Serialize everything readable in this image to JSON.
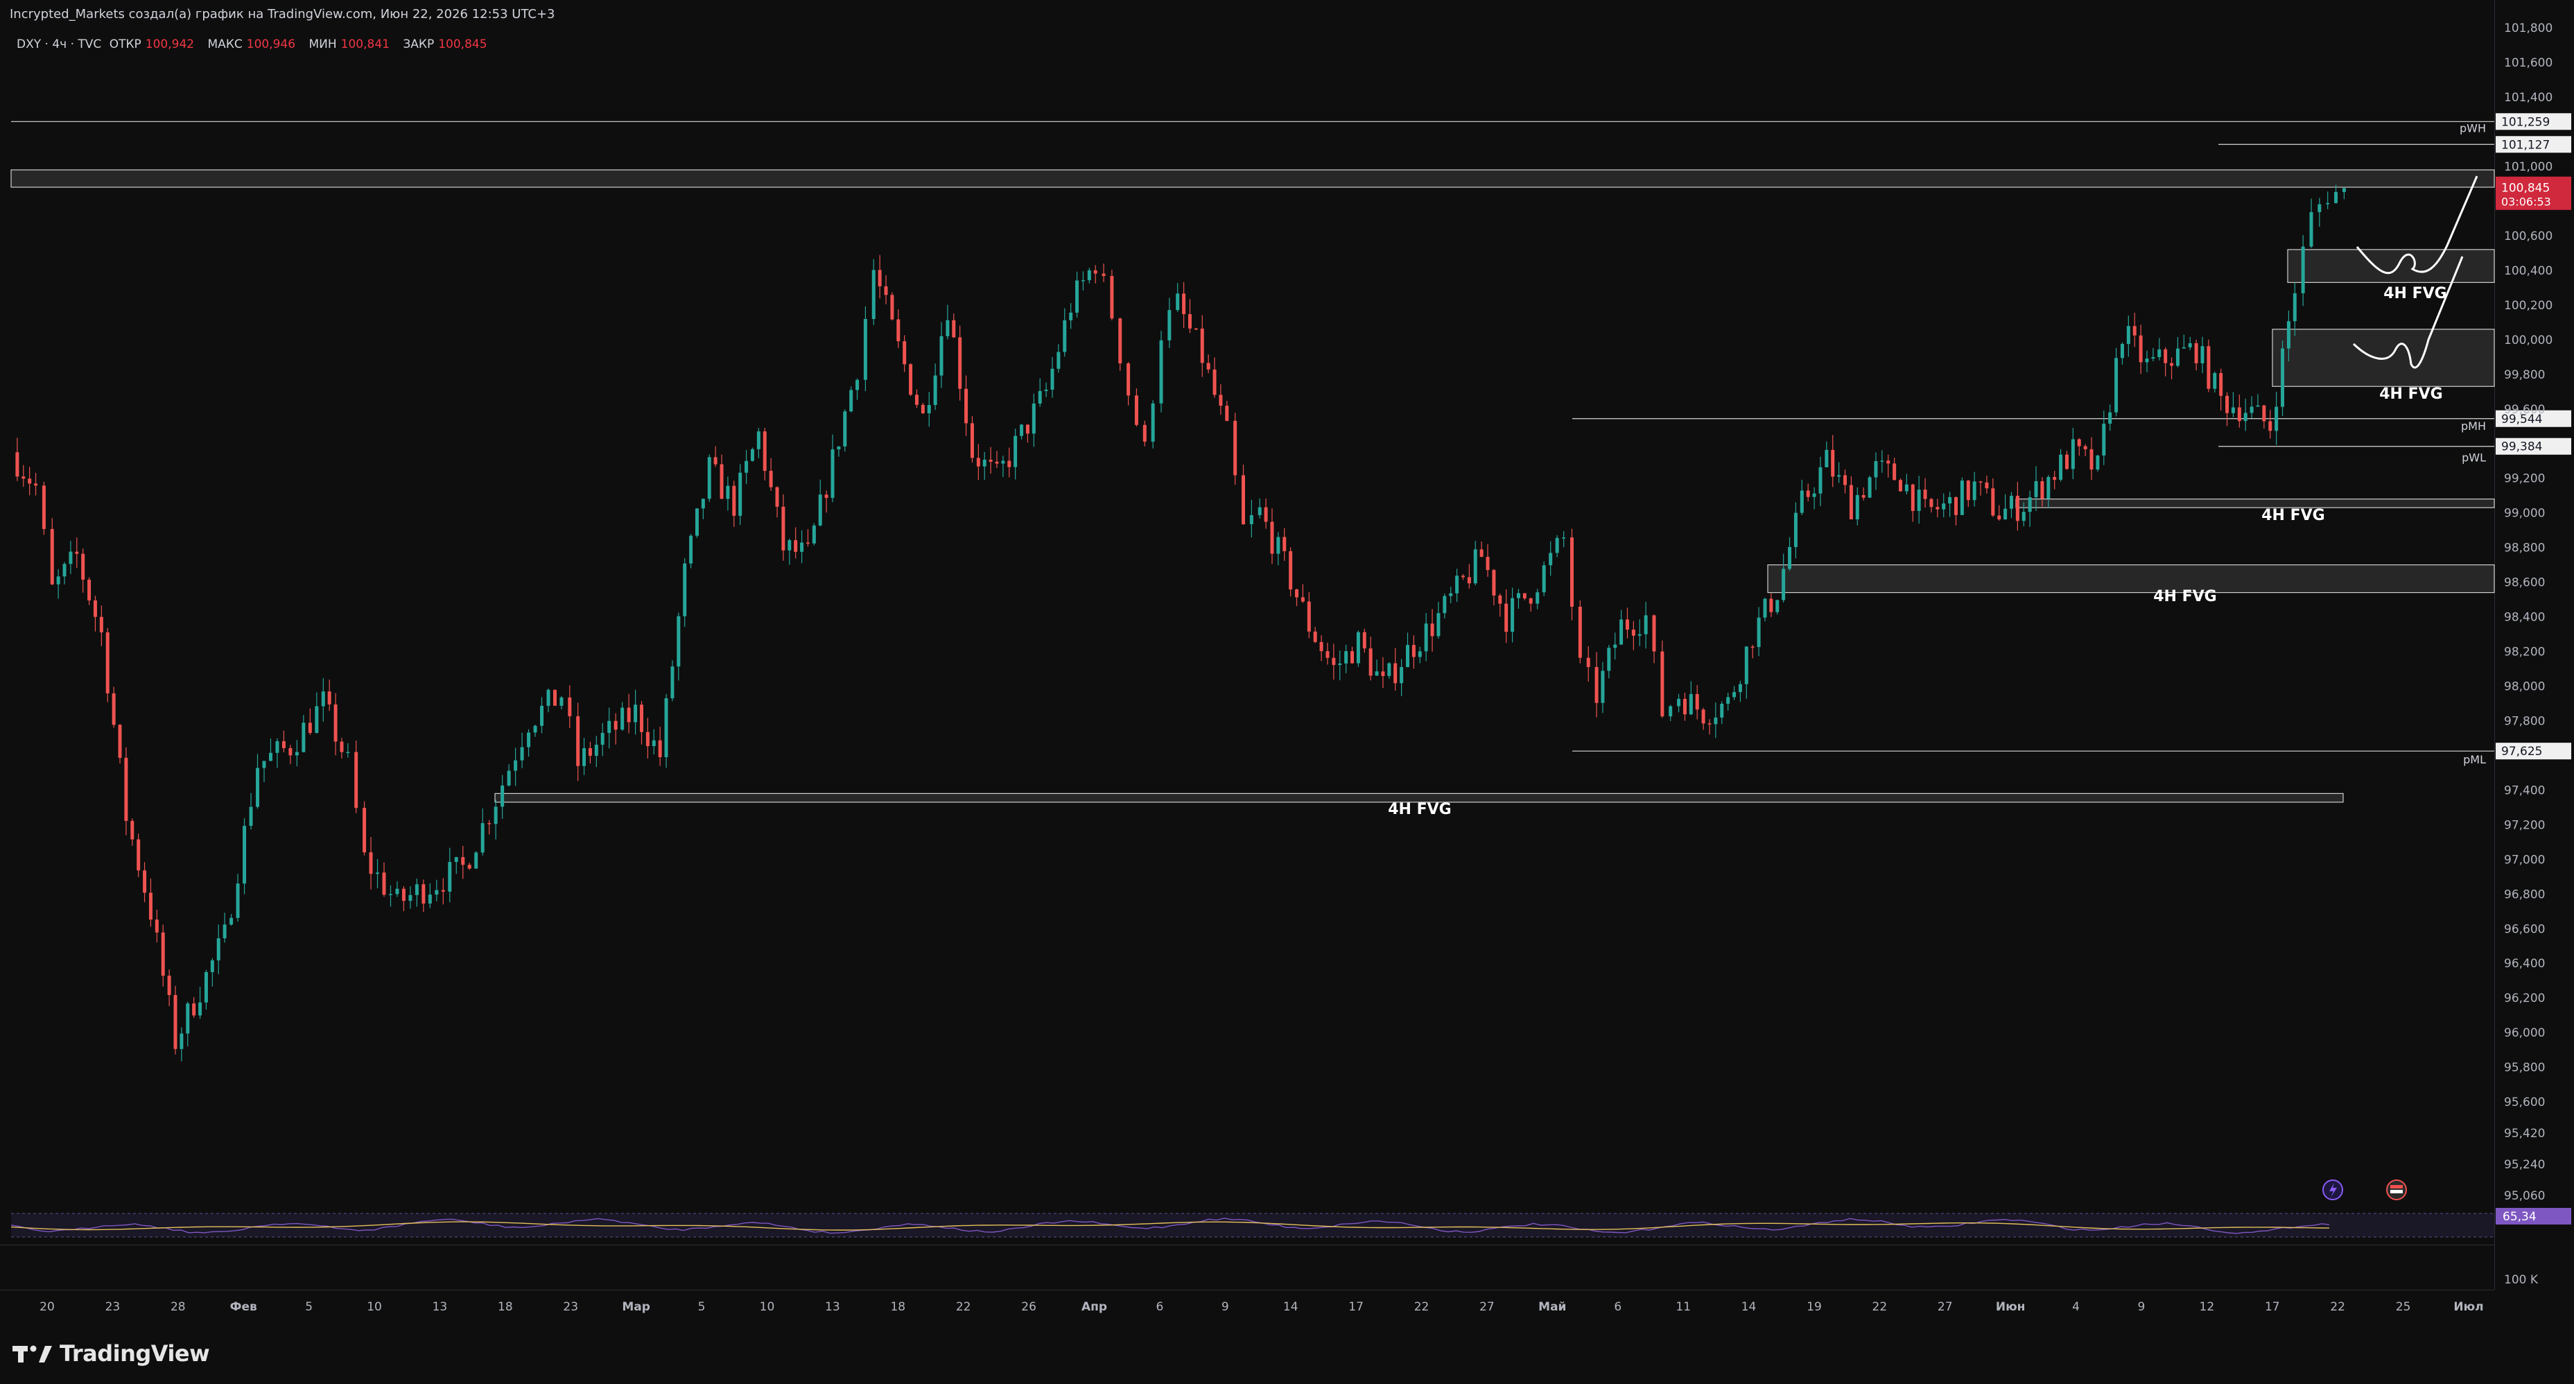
{
  "header": {
    "caption": "Incrypted_Markets создал(а) график на TradingView.com, Июн 22, 2026 12:53 UTC+3"
  },
  "legend": {
    "symbol": "DXY · 4ч · TVC",
    "open_label": "ОТКР",
    "open": "100,942",
    "high_label": "МАКС",
    "high": "100,946",
    "low_label": "МИН",
    "low": "100,841",
    "close_label": "ЗАКР",
    "close": "100,845"
  },
  "colors": {
    "background": "#0e0e0e",
    "up": "#26a69a",
    "down": "#ef5350",
    "price_badge": "#d0283c",
    "rsi": "#7e57c2",
    "rsi_ma": "#e5c15a",
    "level": "#d9d9d9"
  },
  "chart_data": {
    "type": "candlestick",
    "symbol": "DXY",
    "timeframe": "4ч",
    "ylim": [
      95.06,
      101.8
    ],
    "y_ticks": [
      "101,800",
      "101,600",
      "101,400",
      "101,000",
      "100,600",
      "100,400",
      "100,200",
      "100,000",
      "99,800",
      "99,600",
      "99,200",
      "99,000",
      "98,800",
      "98,600",
      "98,400",
      "98,200",
      "98,000",
      "97,800",
      "97,400",
      "97,200",
      "97,000",
      "96,800",
      "96,600",
      "96,400",
      "96,200",
      "96,000",
      "95,800",
      "95,600",
      "95,420",
      "95,240",
      "95,060"
    ],
    "x_ticks": [
      "20",
      "23",
      "28",
      "Фев",
      "5",
      "10",
      "13",
      "18",
      "23",
      "Мар",
      "5",
      "10",
      "13",
      "18",
      "22",
      "26",
      "Апр",
      "6",
      "9",
      "14",
      "17",
      "22",
      "27",
      "Май",
      "6",
      "11",
      "14",
      "19",
      "22",
      "27",
      "Июн",
      "4",
      "9",
      "12",
      "17",
      "22",
      "25",
      "Июл"
    ],
    "price_path": [
      {
        "t": 0.0,
        "p": 99.35
      },
      {
        "t": 0.015,
        "p": 99.15
      },
      {
        "t": 0.025,
        "p": 98.55
      },
      {
        "t": 0.04,
        "p": 98.75
      },
      {
        "t": 0.055,
        "p": 98.3
      },
      {
        "t": 0.07,
        "p": 97.25
      },
      {
        "t": 0.085,
        "p": 96.7
      },
      {
        "t": 0.1,
        "p": 95.95
      },
      {
        "t": 0.115,
        "p": 96.25
      },
      {
        "t": 0.13,
        "p": 96.55
      },
      {
        "t": 0.15,
        "p": 97.55
      },
      {
        "t": 0.17,
        "p": 97.65
      },
      {
        "t": 0.19,
        "p": 97.9
      },
      {
        "t": 0.205,
        "p": 97.55
      },
      {
        "t": 0.215,
        "p": 97.0
      },
      {
        "t": 0.235,
        "p": 96.75
      },
      {
        "t": 0.255,
        "p": 96.85
      },
      {
        "t": 0.275,
        "p": 96.95
      },
      {
        "t": 0.295,
        "p": 97.35
      },
      {
        "t": 0.315,
        "p": 97.8
      },
      {
        "t": 0.335,
        "p": 97.95
      },
      {
        "t": 0.345,
        "p": 97.55
      },
      {
        "t": 0.36,
        "p": 97.7
      },
      {
        "t": 0.38,
        "p": 97.85
      },
      {
        "t": 0.395,
        "p": 97.6
      },
      {
        "t": 0.41,
        "p": 98.65
      },
      {
        "t": 0.425,
        "p": 99.25
      },
      {
        "t": 0.44,
        "p": 99.05
      },
      {
        "t": 0.455,
        "p": 99.45
      },
      {
        "t": 0.47,
        "p": 98.8
      },
      {
        "t": 0.485,
        "p": 98.75
      },
      {
        "t": 0.5,
        "p": 99.3
      },
      {
        "t": 0.515,
        "p": 99.85
      },
      {
        "t": 0.525,
        "p": 100.4
      },
      {
        "t": 0.54,
        "p": 99.95
      },
      {
        "t": 0.555,
        "p": 99.55
      },
      {
        "t": 0.57,
        "p": 100.2
      },
      {
        "t": 0.585,
        "p": 99.35
      },
      {
        "t": 0.6,
        "p": 99.2
      },
      {
        "t": 0.615,
        "p": 99.45
      },
      {
        "t": 0.63,
        "p": 99.7
      },
      {
        "t": 0.645,
        "p": 100.2
      },
      {
        "t": 0.66,
        "p": 100.45
      },
      {
        "t": 0.67,
        "p": 100.15
      },
      {
        "t": 0.68,
        "p": 99.7
      },
      {
        "t": 0.69,
        "p": 99.35
      },
      {
        "t": 0.7,
        "p": 100.05
      },
      {
        "t": 0.71,
        "p": 100.2
      },
      {
        "t": 0.725,
        "p": 99.9
      },
      {
        "t": 0.74,
        "p": 99.45
      },
      {
        "t": 0.75,
        "p": 98.9
      },
      {
        "t": 0.76,
        "p": 99.0
      },
      {
        "t": 0.775,
        "p": 98.7
      },
      {
        "t": 0.79,
        "p": 98.35
      },
      {
        "t": 0.805,
        "p": 98.1
      },
      {
        "t": 0.82,
        "p": 98.25
      },
      {
        "t": 0.835,
        "p": 98.0
      },
      {
        "t": 0.85,
        "p": 98.2
      },
      {
        "t": 0.865,
        "p": 98.35
      },
      {
        "t": 0.88,
        "p": 98.55
      },
      {
        "t": 0.895,
        "p": 98.75
      },
      {
        "t": 0.91,
        "p": 98.4
      },
      {
        "t": 0.925,
        "p": 98.55
      },
      {
        "t": 0.945,
        "p": 98.85
      },
      {
        "t": 0.955,
        "p": 98.1
      },
      {
        "t": 0.965,
        "p": 97.95
      },
      {
        "t": 0.98,
        "p": 98.35
      },
      {
        "t": 0.995,
        "p": 98.4
      },
      {
        "t": 1.005,
        "p": 97.85
      },
      {
        "t": 1.015,
        "p": 97.95
      },
      {
        "t": 1.03,
        "p": 97.85
      },
      {
        "t": 1.045,
        "p": 97.9
      },
      {
        "t": 1.06,
        "p": 98.3
      },
      {
        "t": 1.075,
        "p": 98.55
      },
      {
        "t": 1.09,
        "p": 99.05
      },
      {
        "t": 1.105,
        "p": 99.3
      },
      {
        "t": 1.12,
        "p": 99.05
      },
      {
        "t": 1.135,
        "p": 99.25
      },
      {
        "t": 1.15,
        "p": 99.2
      },
      {
        "t": 1.165,
        "p": 99.0
      },
      {
        "t": 1.18,
        "p": 99.05
      },
      {
        "t": 1.195,
        "p": 99.15
      },
      {
        "t": 1.21,
        "p": 99.0
      },
      {
        "t": 1.225,
        "p": 99.05
      },
      {
        "t": 1.24,
        "p": 99.2
      },
      {
        "t": 1.255,
        "p": 99.35
      },
      {
        "t": 1.27,
        "p": 99.25
      },
      {
        "t": 1.285,
        "p": 100.05
      },
      {
        "t": 1.3,
        "p": 99.85
      },
      {
        "t": 1.315,
        "p": 99.9
      },
      {
        "t": 1.33,
        "p": 99.95
      },
      {
        "t": 1.345,
        "p": 99.65
      },
      {
        "t": 1.36,
        "p": 99.6
      },
      {
        "t": 1.375,
        "p": 99.5
      },
      {
        "t": 1.39,
        "p": 100.3
      },
      {
        "t": 1.4,
        "p": 100.7
      },
      {
        "t": 1.41,
        "p": 100.85
      },
      {
        "t": 1.42,
        "p": 100.845
      }
    ],
    "levels": [
      {
        "price": 101.259,
        "label": "101,259"
      },
      {
        "price": 101.127,
        "label": "101,127",
        "name": "pWH"
      },
      {
        "price": 99.544,
        "label": "99,544",
        "name": "pMH"
      },
      {
        "price": 99.384,
        "label": "99,384",
        "name": "pWL"
      },
      {
        "price": 97.625,
        "label": "97,625",
        "name": "pML"
      }
    ],
    "zones": [
      {
        "top": 100.98,
        "bottom": 100.88,
        "label": ""
      },
      {
        "top": 100.52,
        "bottom": 100.33,
        "label": "4H FVG"
      },
      {
        "top": 100.06,
        "bottom": 99.73,
        "label": "4H FVG"
      },
      {
        "top": 99.08,
        "bottom": 99.03,
        "label": "4H FVG"
      },
      {
        "top": 98.7,
        "bottom": 98.54,
        "label": "4H FVG"
      },
      {
        "top": 97.38,
        "bottom": 97.33,
        "label": "4H FVG"
      }
    ],
    "last_price": {
      "value": "100,845",
      "countdown": "03:06:53"
    },
    "rsi": {
      "value": "65,34"
    },
    "volume_label": "100 K"
  },
  "branding": {
    "name": "TradingView"
  }
}
